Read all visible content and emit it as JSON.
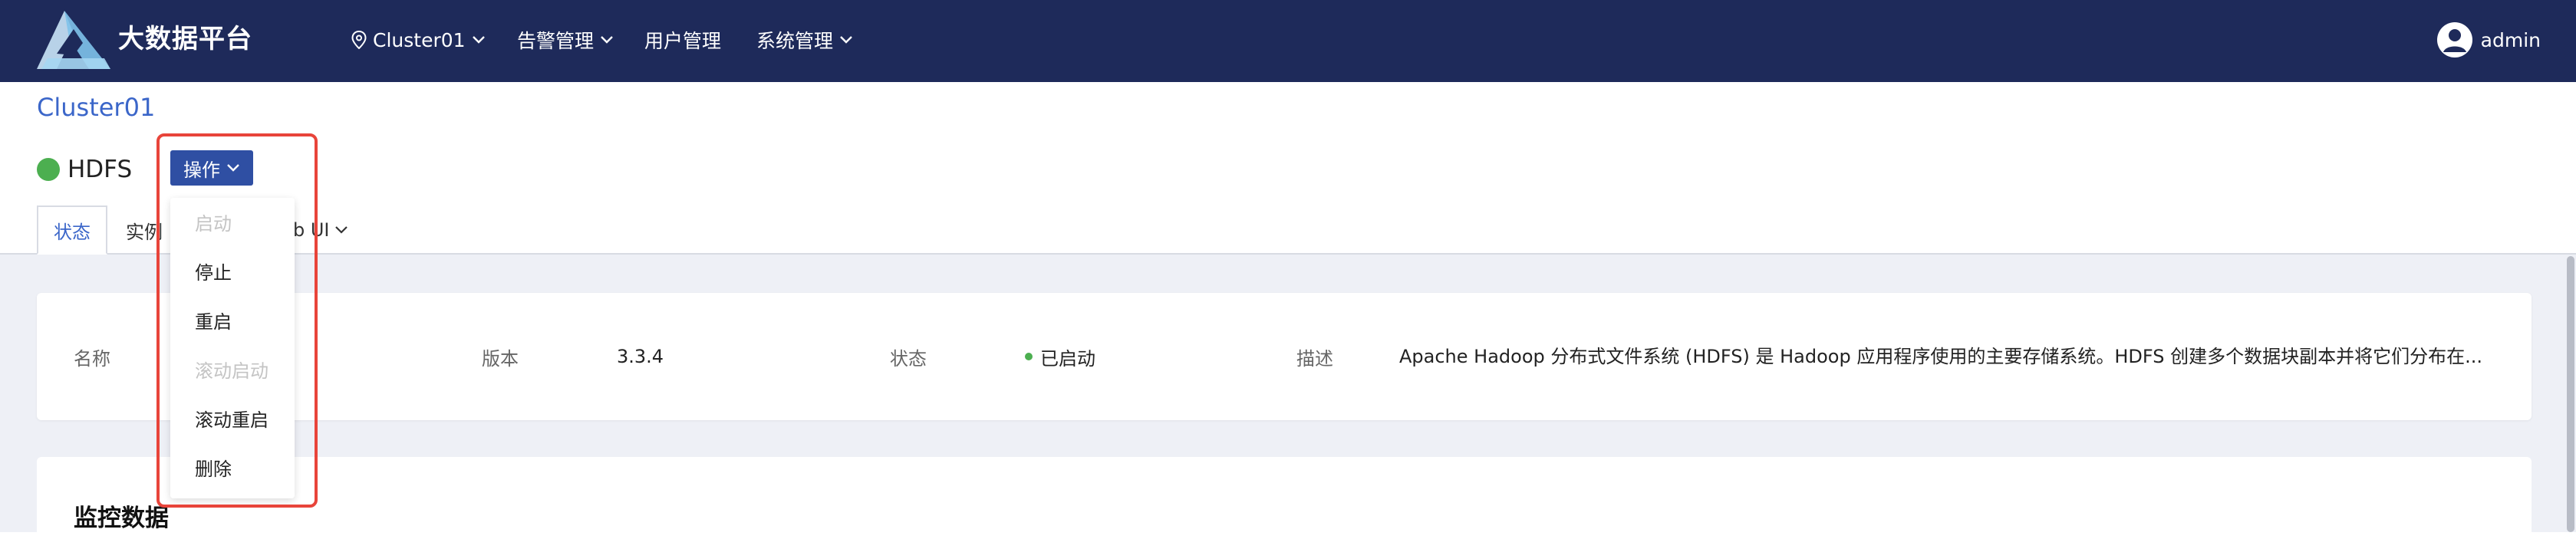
{
  "app": {
    "brand": "大数据平台",
    "brand_logo": "triangle-logo"
  },
  "nav": {
    "cluster": "Cluster01",
    "items": [
      {
        "label": "告警管理",
        "has_dropdown": true
      },
      {
        "label": "用户管理",
        "has_dropdown": false
      },
      {
        "label": "系统管理",
        "has_dropdown": true
      }
    ],
    "user": "admin"
  },
  "breadcrumb": "Cluster01",
  "service": {
    "name": "HDFS",
    "status_color": "#4caf50"
  },
  "actions_button": "操作",
  "tabs": [
    {
      "label": "状态",
      "active": true
    },
    {
      "label": "实例",
      "active": false
    },
    {
      "label": "Web UI",
      "active": false,
      "has_dropdown": true
    }
  ],
  "tab_partial": {
    "instance_visible": "实例",
    "webui_visible": "b UI"
  },
  "actions_menu": [
    {
      "label": "启动",
      "disabled": true
    },
    {
      "label": "停止",
      "disabled": false
    },
    {
      "label": "重启",
      "disabled": false
    },
    {
      "label": "滚动启动",
      "disabled": true
    },
    {
      "label": "滚动重启",
      "disabled": false
    },
    {
      "label": "删除",
      "disabled": false
    }
  ],
  "info": {
    "name_label": "名称",
    "version_label": "版本",
    "version_value": "3.3.4",
    "status_label": "状态",
    "status_value": "已启动",
    "desc_label": "描述",
    "desc_value": "Apache Hadoop 分布式文件系统 (HDFS) 是 Hadoop 应用程序使用的主要存储系统。HDFS 创建多个数据块副本并将它们分布在..."
  },
  "monitor": {
    "title": "监控数据"
  },
  "colors": {
    "nav_bg": "#1e2a5a",
    "accent": "#2f4fa3",
    "link": "#3b66c9",
    "ok": "#4caf50",
    "highlight": "#e8443a"
  }
}
